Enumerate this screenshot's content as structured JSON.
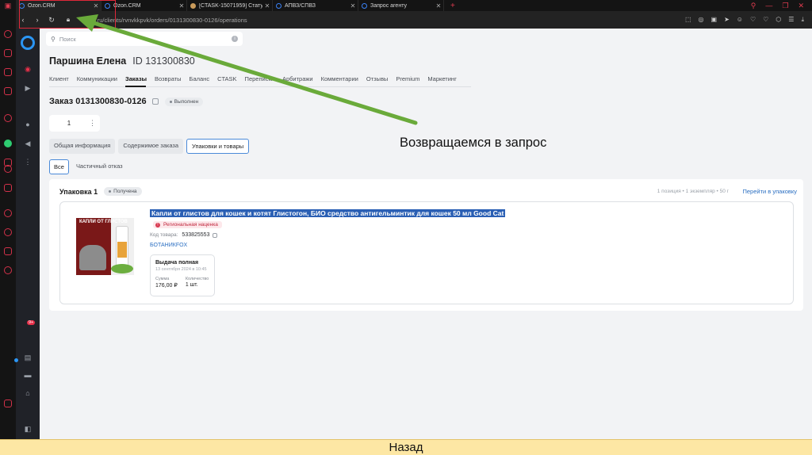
{
  "browser": {
    "tabs": [
      {
        "title": "Ozon.CRM",
        "icon": "ozon-icon",
        "active": true
      },
      {
        "title": "Ozon.CRM",
        "icon": "ozon-icon",
        "active": false
      },
      {
        "title": "[CTASK-15071959] Статус о",
        "icon": "jira-icon",
        "active": false
      },
      {
        "title": "АПВЗ/СПВЗ",
        "icon": "ozon-icon",
        "active": false
      },
      {
        "title": "Запрос агенту",
        "icon": "ozon-icon",
        "active": false
      }
    ],
    "url": "team.ru/clients/rvnvkkpvk/orders/0131300830-0126/operations"
  },
  "search": {
    "placeholder": "Поиск"
  },
  "client": {
    "name": "Паршина Елена",
    "id": "ID 131300830"
  },
  "client_tabs": [
    "Клиент",
    "Коммуникации",
    "Заказы",
    "Возвраты",
    "Баланс",
    "CTASK",
    "Переписки",
    "Арбитражи",
    "Комментарии",
    "Отзывы",
    "Premium",
    "Маркетинг"
  ],
  "order": {
    "title": "Заказ 0131300830-0126",
    "status": "Выполнен",
    "quantity": "1"
  },
  "order_tabs": [
    "Общая информация",
    "Содержимое заказа",
    "Упаковки и товары"
  ],
  "filters": [
    "Все",
    "Частичный отказ"
  ],
  "package": {
    "title": "Упаковка 1",
    "status": "Получена",
    "meta": "1 позиция • 1 экземпляр • 50 г",
    "link": "Перейти в упаковку",
    "item": {
      "name": "Капли от глистов для кошек и котят Глистогон, БИО средство антигельминтик для кошек 50 мл Good Cat",
      "tag": "Региональная наценка",
      "sku_label": "Код товара:",
      "sku": "533825553",
      "seller": "БОТАНИКFOX",
      "thumb_text": "КАПЛИ ОТ ГЛИСТОВ",
      "issue": {
        "title": "Выдача полная",
        "date": "13 сентября 2024 в 10:45",
        "sum_label": "Сумма",
        "sum": "176,00 ₽",
        "qty_label": "Количество",
        "qty": "1 шт."
      }
    }
  },
  "annotation": {
    "text": "Возвращаемся в запрос",
    "arrow_color": "#6aaa3a",
    "highlight_color": "#e0283a"
  },
  "footer": {
    "text": "Назад"
  },
  "sidebar_badge": "9+"
}
